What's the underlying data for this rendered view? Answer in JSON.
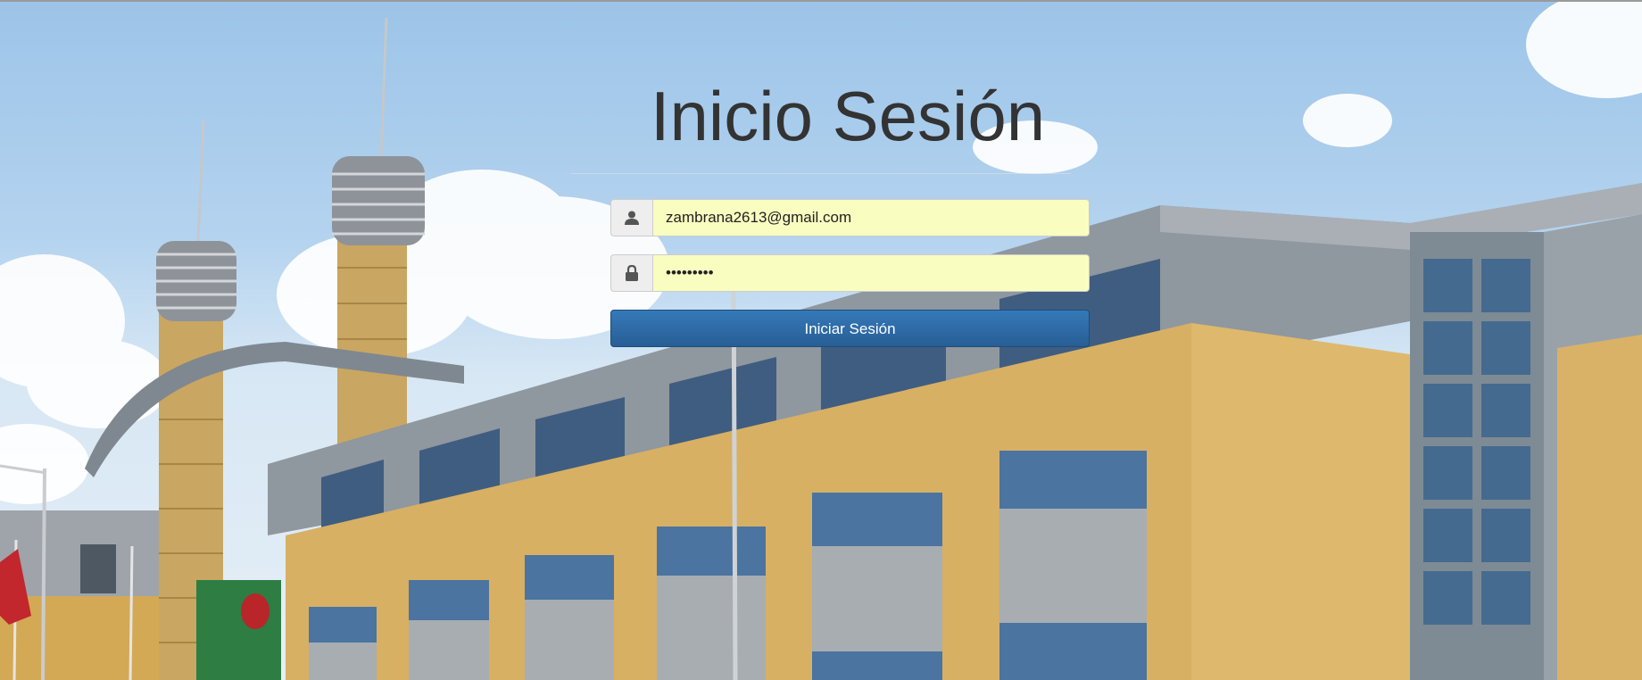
{
  "login": {
    "title": "Inicio Sesión",
    "email_value": "zambrana2613@gmail.com",
    "password_value": "zambrana!",
    "submit_label": "Iniciar Sesión"
  },
  "icons": {
    "user": "user-icon",
    "password": "lock-icon"
  },
  "colors": {
    "input_bg": "#fafdc0",
    "button_bg": "#2d6ca5",
    "title_text": "#333333"
  }
}
